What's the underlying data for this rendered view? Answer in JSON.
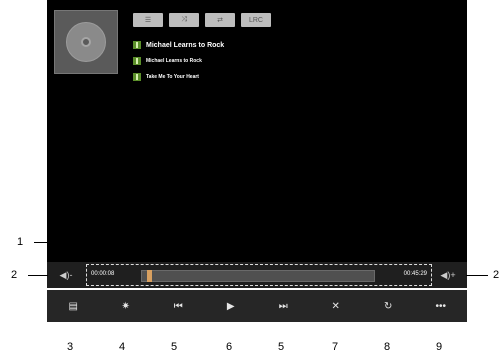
{
  "player": {
    "mode_buttons": [
      "☰",
      "⤨",
      "⇄",
      "LRC"
    ],
    "lines": [
      "Michael Learns to Rock",
      "Michael Learns to Rock",
      "Take Me To Your Heart"
    ],
    "progress": 0.02,
    "elapsed": "00:00:08",
    "total": "00:45:29",
    "volume_down": "◀)-",
    "volume_up": "◀)+"
  },
  "controls": [
    "▤",
    "✷",
    "⏮",
    "▶",
    "⏭",
    "✕",
    "↻",
    "•••"
  ],
  "callouts": [
    "1",
    "2",
    "2"
  ],
  "numbers": [
    "3",
    "4",
    "5",
    "6",
    "5",
    "7",
    "8",
    "9"
  ]
}
